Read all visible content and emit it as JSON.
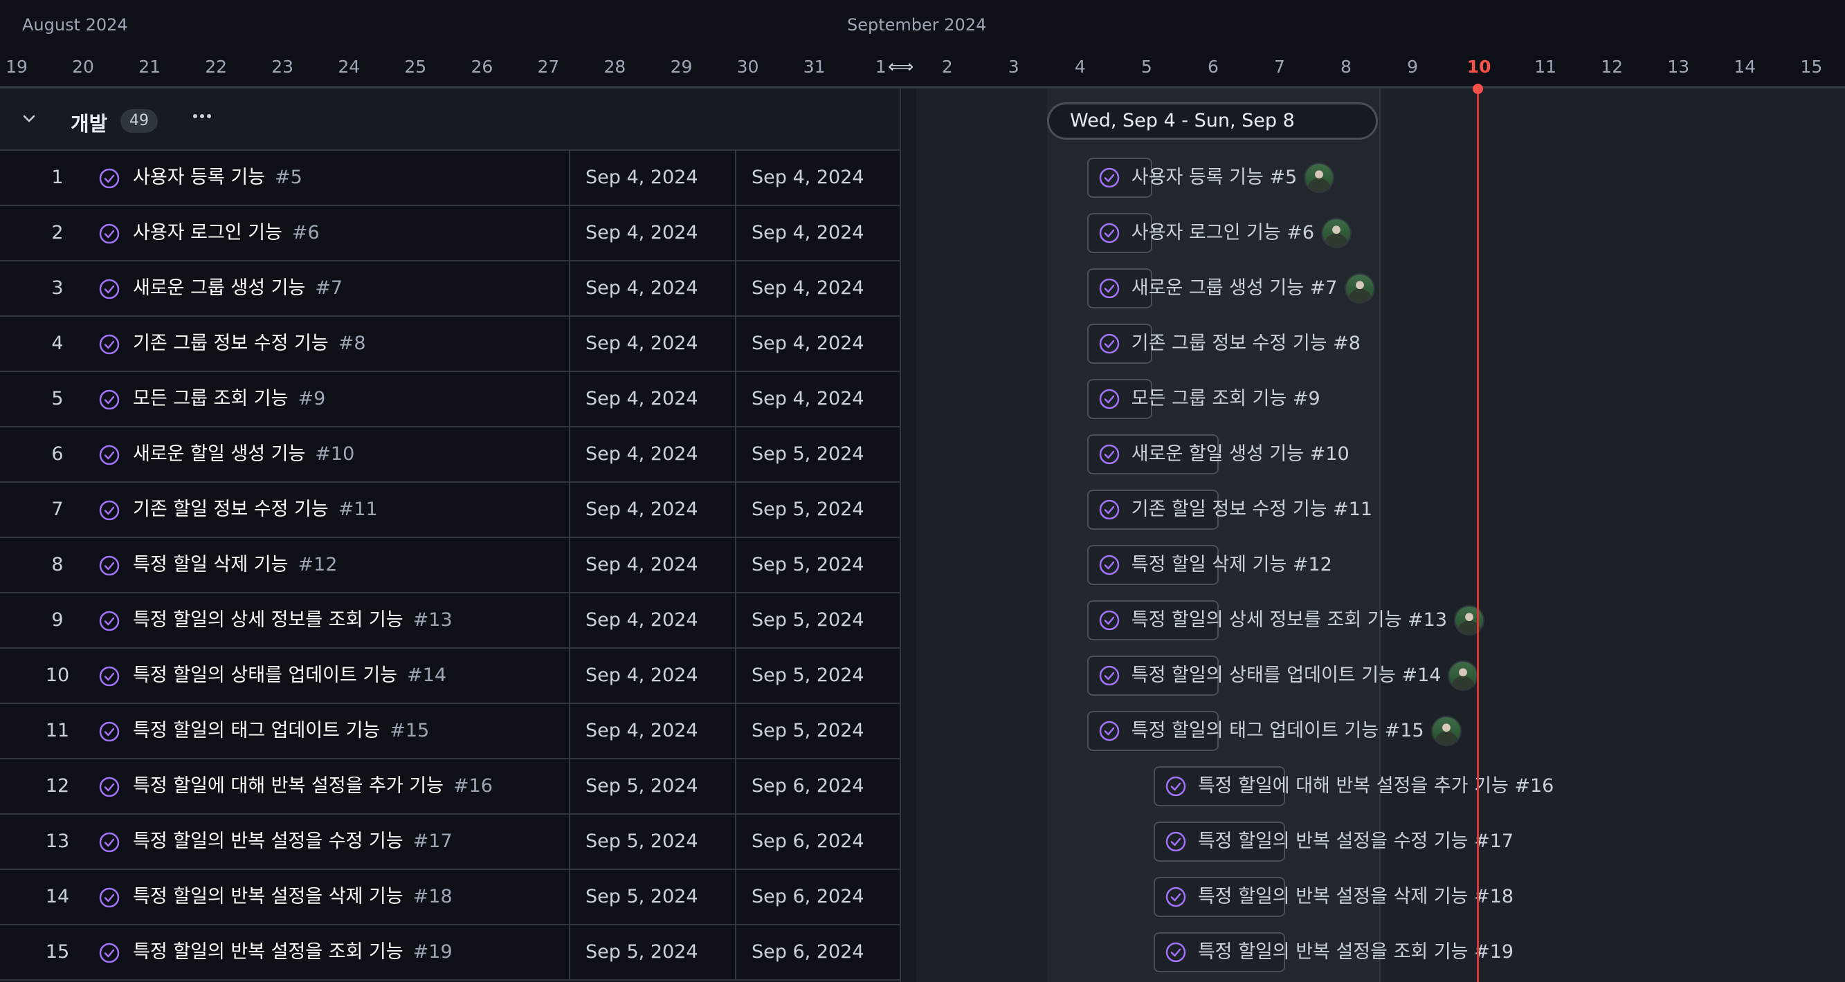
{
  "timeline": {
    "months": [
      "August 2024",
      "September 2024"
    ],
    "days": [
      "19",
      "20",
      "21",
      "22",
      "23",
      "24",
      "25",
      "26",
      "27",
      "28",
      "29",
      "30",
      "31",
      "1",
      "2",
      "3",
      "4",
      "5",
      "6",
      "7",
      "8",
      "9",
      "10",
      "11",
      "12",
      "13",
      "14",
      "15"
    ],
    "today": "10",
    "selected_range": "Wed, Sep 4 - Sun, Sep 8",
    "today_color": "#f85149"
  },
  "group": {
    "name": "개발",
    "count": "49",
    "more_icon": "ellipsis-icon",
    "collapse_icon": "chevron-down-icon"
  },
  "status_color": "#a371f7",
  "rows": [
    {
      "num": "1",
      "title": "사용자 등록 기능",
      "issue": "#5",
      "start": "Sep 4, 2024",
      "end": "Sep 4, 2024",
      "bar_label": "사용자 등록 기능 #5",
      "avatar": true
    },
    {
      "num": "2",
      "title": "사용자 로그인 기능",
      "issue": "#6",
      "start": "Sep 4, 2024",
      "end": "Sep 4, 2024",
      "bar_label": "사용자 로그인 기능 #6",
      "avatar": true
    },
    {
      "num": "3",
      "title": "새로운 그룹 생성 기능",
      "issue": "#7",
      "start": "Sep 4, 2024",
      "end": "Sep 4, 2024",
      "bar_label": "새로운 그룹 생성 기능 #7",
      "avatar": true
    },
    {
      "num": "4",
      "title": "기존 그룹 정보 수정 기능",
      "issue": "#8",
      "start": "Sep 4, 2024",
      "end": "Sep 4, 2024",
      "bar_label": "기존 그룹 정보 수정 기능 #8",
      "avatar": false
    },
    {
      "num": "5",
      "title": "모든 그룹 조회 기능",
      "issue": "#9",
      "start": "Sep 4, 2024",
      "end": "Sep 4, 2024",
      "bar_label": "모든 그룹 조회 기능 #9",
      "avatar": false
    },
    {
      "num": "6",
      "title": "새로운 할일 생성 기능",
      "issue": "#10",
      "start": "Sep 4, 2024",
      "end": "Sep 5, 2024",
      "bar_label": "새로운 할일 생성 기능 #10",
      "avatar": false
    },
    {
      "num": "7",
      "title": "기존 할일 정보 수정 기능",
      "issue": "#11",
      "start": "Sep 4, 2024",
      "end": "Sep 5, 2024",
      "bar_label": "기존 할일 정보 수정 기능 #11",
      "avatar": false
    },
    {
      "num": "8",
      "title": "특정 할일 삭제 기능",
      "issue": "#12",
      "start": "Sep 4, 2024",
      "end": "Sep 5, 2024",
      "bar_label": "특정 할일 삭제 기능 #12",
      "avatar": false
    },
    {
      "num": "9",
      "title": "특정 할일의 상세 정보를 조회 기능",
      "issue": "#13",
      "start": "Sep 4, 2024",
      "end": "Sep 5, 2024",
      "bar_label": "특정 할일의 상세 정보를 조회 기능 #13",
      "avatar": true
    },
    {
      "num": "10",
      "title": "특정 할일의 상태를 업데이트 기능",
      "issue": "#14",
      "start": "Sep 4, 2024",
      "end": "Sep 5, 2024",
      "bar_label": "특정 할일의 상태를 업데이트 기능 #14",
      "avatar": true
    },
    {
      "num": "11",
      "title": "특정 할일의 태그 업데이트 기능",
      "issue": "#15",
      "start": "Sep 4, 2024",
      "end": "Sep 5, 2024",
      "bar_label": "특정 할일의 태그 업데이트 기능 #15",
      "avatar": true
    },
    {
      "num": "12",
      "title": "특정 할일에 대해 반복 설정을 추가 기능",
      "issue": "#16",
      "start": "Sep 5, 2024",
      "end": "Sep 6, 2024",
      "bar_label": "특정 할일에 대해 반복 설정을 추가 기능 #16",
      "avatar": false
    },
    {
      "num": "13",
      "title": "특정 할일의 반복 설정을 수정 기능",
      "issue": "#17",
      "start": "Sep 5, 2024",
      "end": "Sep 6, 2024",
      "bar_label": "특정 할일의 반복 설정을 수정 기능 #17",
      "avatar": false
    },
    {
      "num": "14",
      "title": "특정 할일의 반복 설정을 삭제 기능",
      "issue": "#18",
      "start": "Sep 5, 2024",
      "end": "Sep 6, 2024",
      "bar_label": "특정 할일의 반복 설정을 삭제 기능 #18",
      "avatar": false
    },
    {
      "num": "15",
      "title": "특정 할일의 반복 설정을 조회 기능",
      "issue": "#19",
      "start": "Sep 5, 2024",
      "end": "Sep 6, 2024",
      "bar_label": "특정 할일의 반복 설정을 조회 기능 #19",
      "avatar": false
    }
  ]
}
